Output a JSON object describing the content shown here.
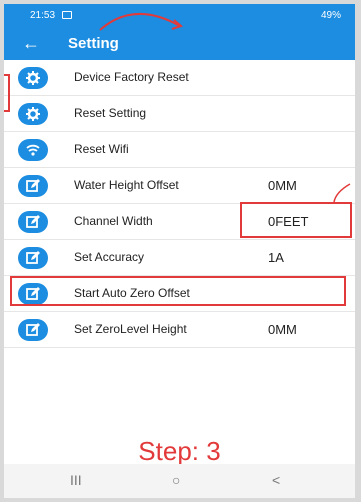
{
  "status_bar": {
    "time": "21:53",
    "right": "49%"
  },
  "app_bar": {
    "back": "←",
    "title": "Setting"
  },
  "items": [
    {
      "label": "Device Factory Reset",
      "value": "",
      "icon": "gear-icon"
    },
    {
      "label": "Reset Setting",
      "value": "",
      "icon": "gear-icon"
    },
    {
      "label": "Reset Wifi",
      "value": "",
      "icon": "wifi-icon"
    },
    {
      "label": "Water Height Offset",
      "value": "0MM",
      "icon": "edit-icon"
    },
    {
      "label": "Channel Width",
      "value": "0FEET",
      "icon": "edit-icon"
    },
    {
      "label": "Set Accuracy",
      "value": "1A",
      "icon": "edit-icon"
    },
    {
      "label": "Start Auto Zero Offset",
      "value": "",
      "icon": "edit-icon"
    },
    {
      "label": "Set ZeroLevel Height",
      "value": "0MM",
      "icon": "edit-icon"
    }
  ],
  "annotation": {
    "step": "Step: 3"
  },
  "nav": {
    "recent": "III",
    "home": "○",
    "back": "<"
  },
  "colors": {
    "primary": "#1c8de0",
    "annotation": "#e23a3a"
  }
}
